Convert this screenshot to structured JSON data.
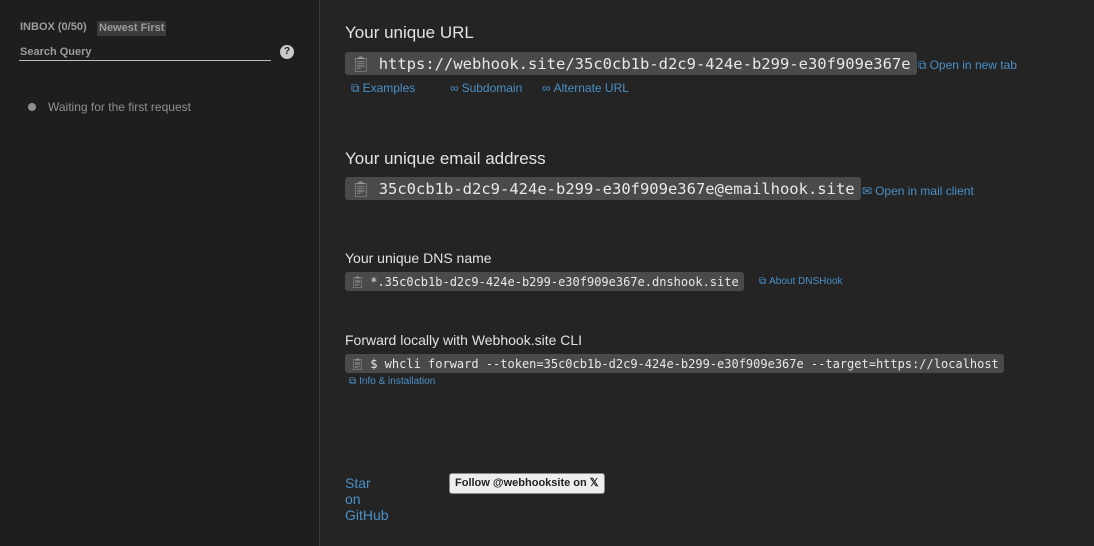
{
  "sidebar": {
    "inbox_label": "INBOX (0/50)",
    "sort_label": "Newest First",
    "search_placeholder": "Search Query",
    "help_label": "?",
    "waiting_text": "Waiting for the first request"
  },
  "url_section": {
    "title": "Your unique URL",
    "url": "https://webhook.site/35c0cb1b-d2c9-424e-b299-e30f909e367e",
    "open_tab_label": "Open in new tab",
    "examples_label": "Examples",
    "subdomain_label": "Subdomain",
    "alternate_label": "Alternate URL"
  },
  "email_section": {
    "title": "Your unique email address",
    "email": "35c0cb1b-d2c9-424e-b299-e30f909e367e@emailhook.site",
    "open_mail_label": "Open in mail client"
  },
  "dns_section": {
    "title": "Your unique DNS name",
    "dns": "*.35c0cb1b-d2c9-424e-b299-e30f909e367e.dnshook.site",
    "about_label": "About DNSHook"
  },
  "cli_section": {
    "title": "Forward locally with Webhook.site CLI",
    "command": "$ whcli forward --token=35c0cb1b-d2c9-424e-b299-e30f909e367e --target=https://localhost",
    "info_label": "Info & installation"
  },
  "footer": {
    "github_label": "Star on GitHub",
    "follow_label": "Follow @webhooksite on 𝕏"
  },
  "icons": {
    "clipboard": "clipboard-icon",
    "external": "external-link-icon",
    "chain": "link-icon",
    "mail": "envelope-icon"
  },
  "colors": {
    "accent_link": "#4a90c6",
    "sidebar_bg": "#1e1e1e",
    "main_bg": "#242424",
    "code_bg": "#4a4a4a"
  }
}
